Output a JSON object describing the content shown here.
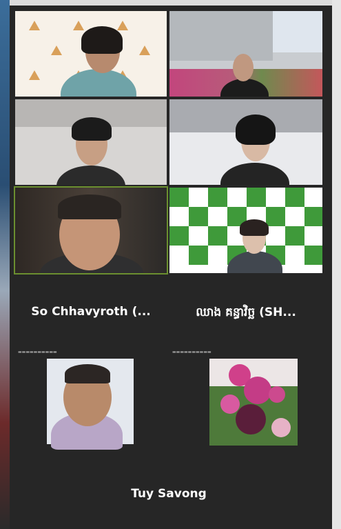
{
  "participants": {
    "so_chhavyroth": {
      "name": "So Chhavyroth (..."
    },
    "sh_participant": {
      "name": "ឈាង គន្ធាវិច្ឆ (SH..."
    },
    "tuy_savong": {
      "name": "Tuy Savong"
    }
  },
  "colors": {
    "background": "#262626",
    "active_speaker_border": "#6b8f2f"
  },
  "icons": {
    "logo_pattern": "triangle-logo",
    "sponsor_pattern": "leaf-logo"
  }
}
